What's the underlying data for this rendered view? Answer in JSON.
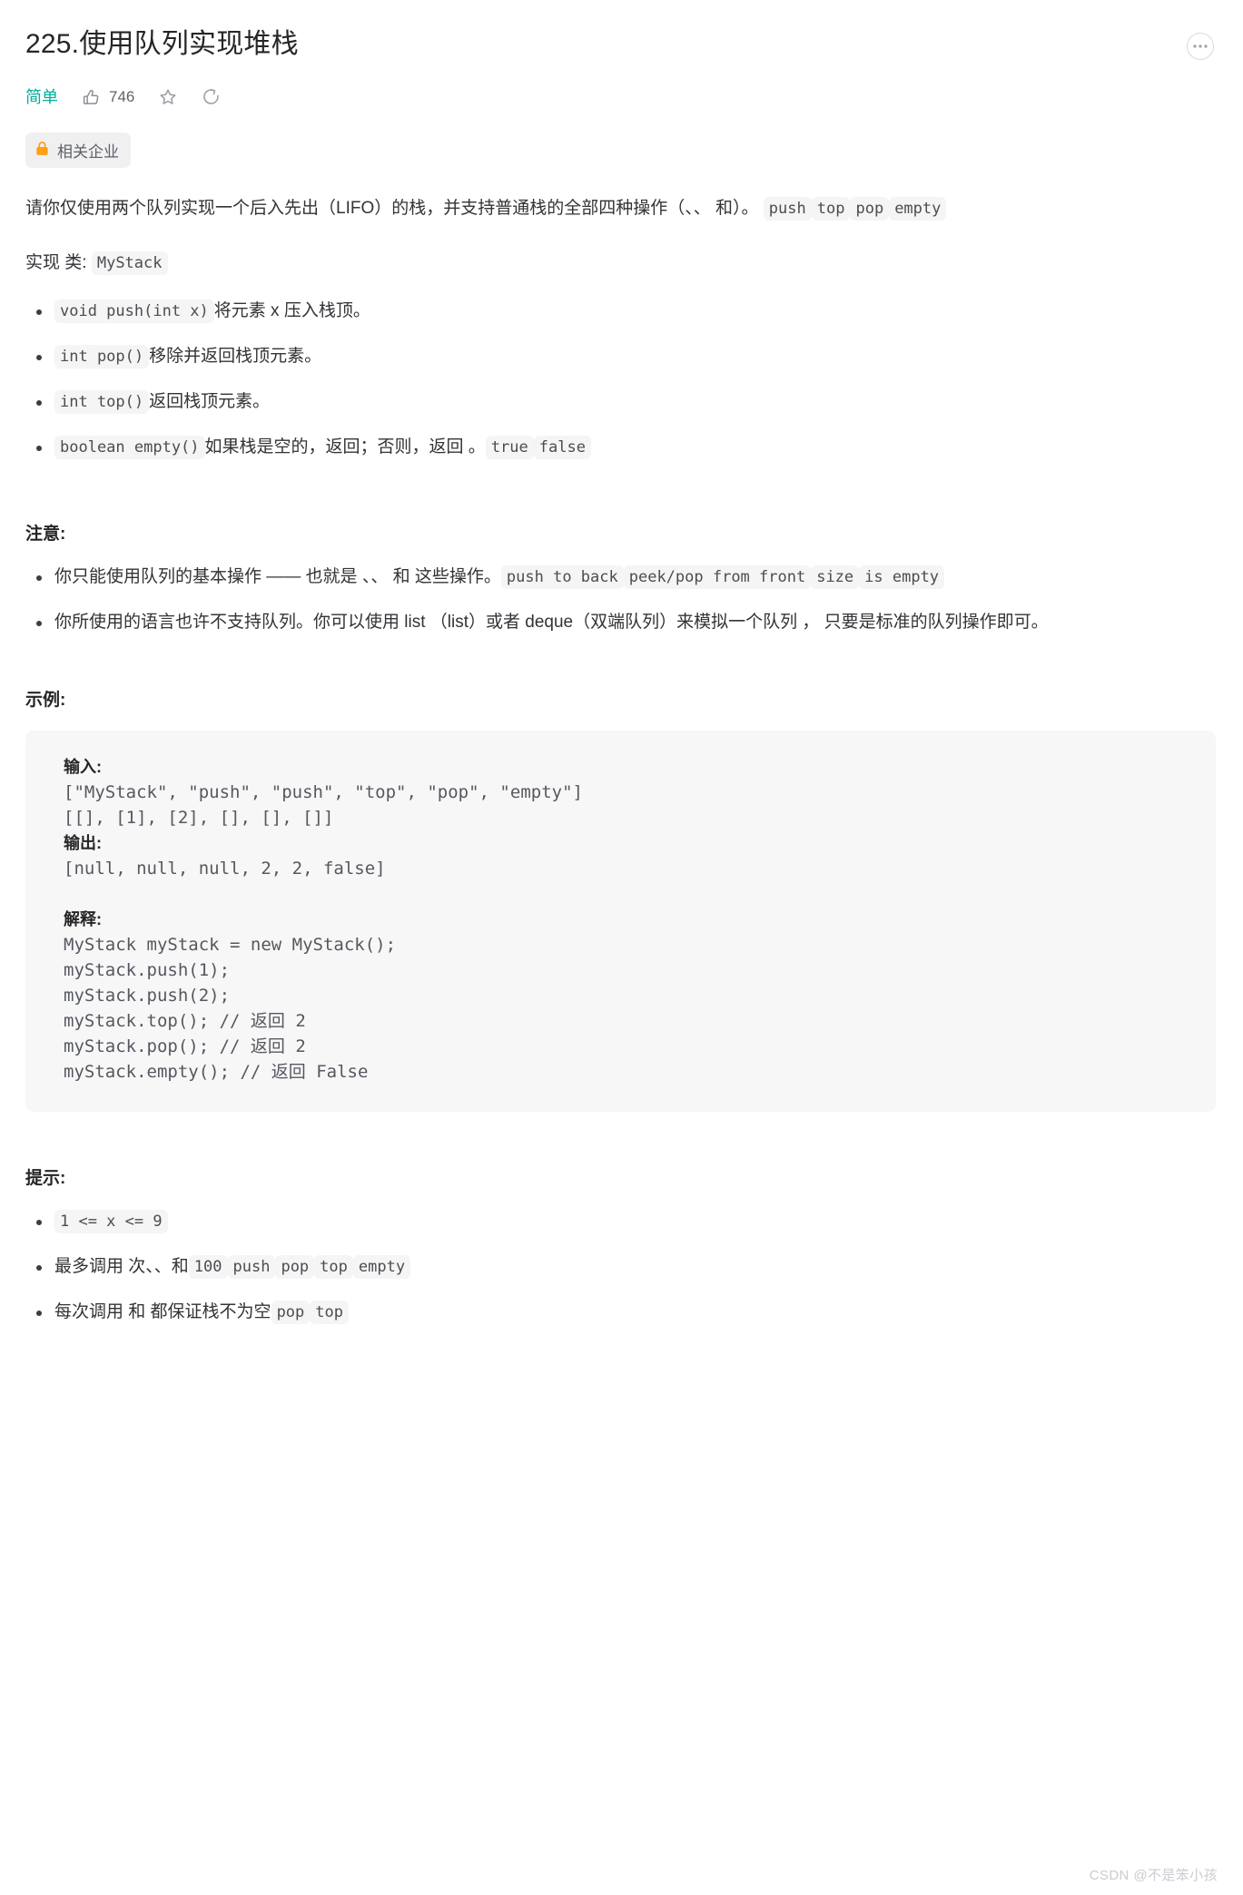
{
  "header": {
    "title": "225.使用队列实现堆栈",
    "difficulty": "简单",
    "like_count": "746",
    "icons": {
      "more": "more-horizontal-icon",
      "thumbs_up": "thumbs-up-icon",
      "star": "star-icon",
      "share": "share-icon",
      "lock": "lock-icon"
    },
    "company_badge": "相关企业",
    "accent_color": "#00af9b",
    "lock_color": "#ffa116"
  },
  "description": {
    "intro_prefix": "请你仅使用两个队列实现一个后入先出（LIFO）的栈，并支持普通栈的全部四种操作（、、 和）。",
    "intro_chips": [
      "push",
      "top",
      "pop",
      "empty"
    ],
    "class_label": "实现 类:",
    "class_name": "MyStack",
    "methods": [
      {
        "code": "void push(int x)",
        "text": "将元素 x 压入栈顶。",
        "chips": []
      },
      {
        "code": "int pop()",
        "text": "移除并返回栈顶元素。",
        "chips": []
      },
      {
        "code": "int top()",
        "text": "返回栈顶元素。",
        "chips": []
      },
      {
        "code": "boolean empty()",
        "text": "如果栈是空的，返回；否则，返回 。",
        "chips": [
          "true",
          "false"
        ]
      }
    ]
  },
  "notes": {
    "heading": "注意:",
    "items": [
      {
        "text": "你只能使用队列的基本操作 —— 也就是 、、 和 这些操作。",
        "chips": [
          "push to back",
          "peek/pop from front",
          "size",
          "is empty"
        ]
      },
      {
        "text": "你所使用的语言也许不支持队列。你可以使用 list （list）或者 deque（双端队列）来模拟一个队列 ， 只要是标准的队列操作即可。",
        "chips": []
      }
    ]
  },
  "example": {
    "heading": "示例:",
    "input_label": "输入:",
    "input_lines": [
      "[\"MyStack\", \"push\", \"push\", \"top\", \"pop\", \"empty\"]",
      "[[], [1], [2], [], [], []]"
    ],
    "output_label": "输出:",
    "output_lines": [
      "[null, null, null, 2, 2, false]"
    ],
    "explain_label": "解释:",
    "explain_lines": [
      "MyStack myStack = new MyStack();",
      "myStack.push(1);",
      "myStack.push(2);",
      "myStack.top(); // 返回 2",
      "myStack.pop(); // 返回 2",
      "myStack.empty(); // 返回 False"
    ]
  },
  "hints": {
    "heading": "提示:",
    "items": [
      {
        "text": "",
        "chips": [
          "1 <= x <= 9"
        ],
        "chips_first": true
      },
      {
        "text": "最多调用 次、、和",
        "chips": [
          "100",
          "push",
          "pop",
          "top",
          "empty"
        ],
        "chips_first": false
      },
      {
        "text": "每次调用 和 都保证栈不为空",
        "chips": [
          "pop",
          "top"
        ],
        "chips_first": false
      }
    ]
  },
  "watermark": "CSDN @不是笨小孩"
}
